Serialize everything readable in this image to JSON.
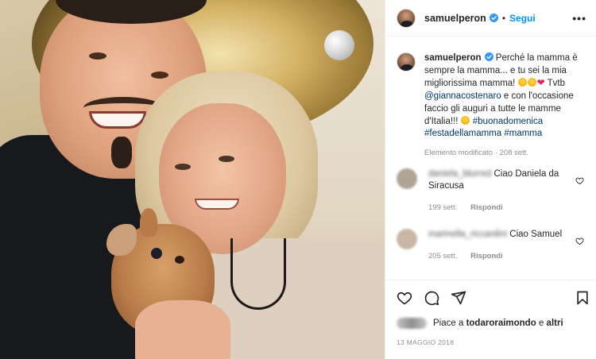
{
  "post": {
    "username": "samuelperon",
    "follow_label": "Segui",
    "separator": "•",
    "more_label": "•••"
  },
  "caption": {
    "username": "samuelperon",
    "text_1": "Perché la mamma è sempre la mamma... e tu sei la mia migliorissima mamma!",
    "text_2": "Tvtb",
    "mention": "@giannacostenaro",
    "text_3": "e con l'occasione faccio gli auguri a tutte le mamme d'Italia!!!",
    "hashtag_1": "#buonadomenica",
    "hashtag_2": "#festadellamamma",
    "hashtag_3": "#mamma",
    "meta": "Elemento modificato · 208 sett."
  },
  "comments": [
    {
      "username": "daniela_blurred",
      "text": "Ciao Daniela da Siracusa",
      "time": "199 sett.",
      "reply_label": "Rispondi",
      "avatar_color": "#b0a496"
    },
    {
      "username": "marinella_riccardini",
      "text": "Ciao Samuel",
      "time": "205 sett.",
      "reply_label": "Rispondi",
      "avatar_color": "#c9b7a6"
    }
  ],
  "actions": {
    "icons": [
      "heart-icon",
      "comment-icon",
      "share-icon",
      "bookmark-icon"
    ]
  },
  "likes": {
    "prefix": "Piace a",
    "user": "todaroraimondo",
    "suffix": "e",
    "others": "altri"
  },
  "date": "13 maggio 2018",
  "colors": {
    "accent": "#0095f6",
    "link": "#00376b",
    "muted": "#8e8e8e",
    "verified": "#3897f0"
  }
}
